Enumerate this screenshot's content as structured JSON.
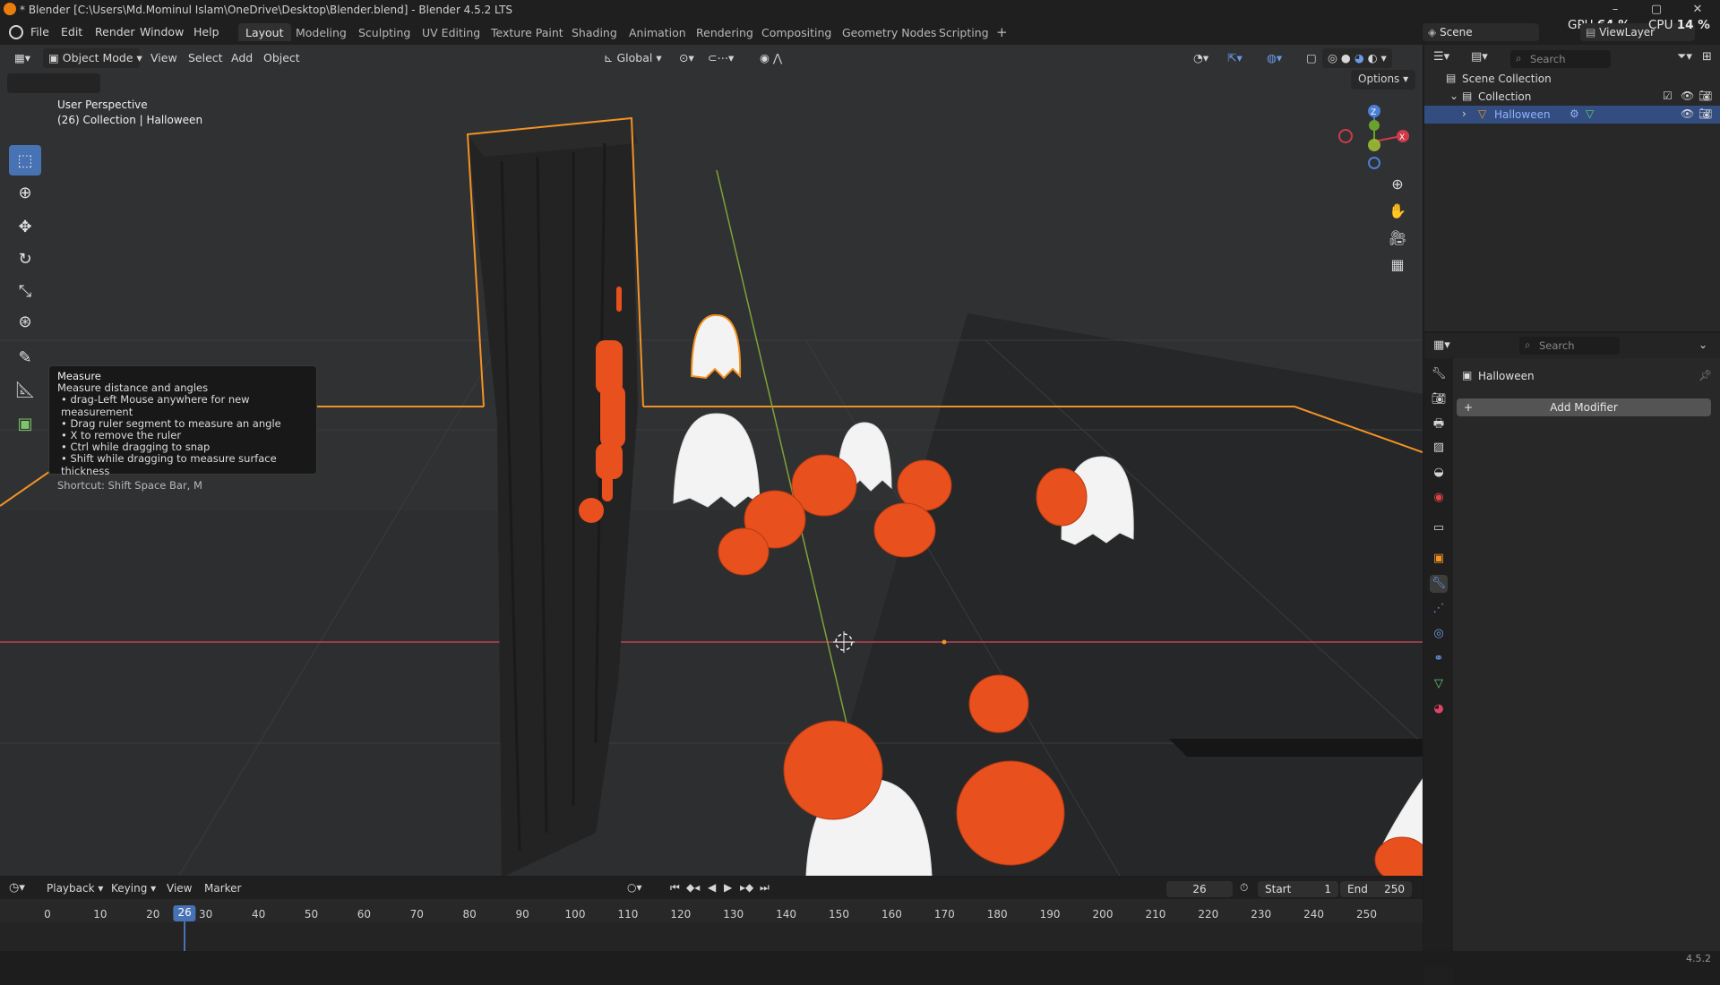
{
  "window": {
    "title": "* Blender [C:\\Users\\Md.Mominul Islam\\OneDrive\\Desktop\\Blender.blend] - Blender 4.5.2 LTS",
    "controls": [
      "–",
      "▢",
      "✕"
    ]
  },
  "menu": [
    "File",
    "Edit",
    "Render",
    "Window",
    "Help"
  ],
  "workspaces": {
    "active": "Layout",
    "tabs": [
      "Layout",
      "Modeling",
      "Sculpting",
      "UV Editing",
      "Texture Paint",
      "Shading",
      "Animation",
      "Rendering",
      "Compositing",
      "Geometry Nodes",
      "Scripting"
    ],
    "add": "+"
  },
  "scene_header": {
    "scene": "Scene",
    "view_layer": "ViewLayer",
    "gpu_label": "GPU",
    "gpu_value": "64 %",
    "cpu_label": "CPU",
    "cpu_value": "14 %"
  },
  "viewport": {
    "mode": "Object Mode",
    "menus": [
      "View",
      "Select",
      "Add",
      "Object"
    ],
    "orientation": "Global",
    "options": "Options",
    "perspective": "User Perspective",
    "collection_info": "(26) Collection | Halloween",
    "gizmo": {
      "x": "X",
      "y": "Y",
      "z": "Z"
    }
  },
  "tooltip": {
    "title": "Measure",
    "description": "Measure distance and angles",
    "bullets": [
      "drag-Left Mouse anywhere for new measurement",
      "Drag ruler segment to measure an angle",
      "X to remove the ruler",
      "Ctrl while dragging to snap",
      "Shift while dragging to measure surface thickness"
    ],
    "shortcut": "Shortcut: Shift Space Bar, M"
  },
  "outliner": {
    "search_placeholder": "Search",
    "scene_collection": "Scene Collection",
    "collection": "Collection",
    "object": "Halloween"
  },
  "properties": {
    "search_placeholder": "Search",
    "object_name": "Halloween",
    "add_modifier": "Add Modifier"
  },
  "timeline": {
    "menus": [
      "Playback",
      "Keying",
      "View",
      "Marker"
    ],
    "current_frame": "26",
    "start_label": "Start",
    "start_value": "1",
    "end_label": "End",
    "end_value": "250",
    "ruler": [
      "0",
      "10",
      "20",
      "30",
      "40",
      "50",
      "60",
      "70",
      "80",
      "90",
      "100",
      "110",
      "120",
      "130",
      "140",
      "150",
      "160",
      "170",
      "180",
      "190",
      "200",
      "210",
      "220",
      "230",
      "240",
      "250"
    ],
    "playhead": "26"
  },
  "status": {
    "version": "4.5.2"
  },
  "colors": {
    "accent": "#4772b3",
    "selection_outline": "#f39224",
    "pumpkin": "#e8501e",
    "ghost": "#f5f5f5",
    "x_axis": "#cf3a4b",
    "y_axis": "#6aa12d",
    "z_axis": "#4b7ed6"
  }
}
